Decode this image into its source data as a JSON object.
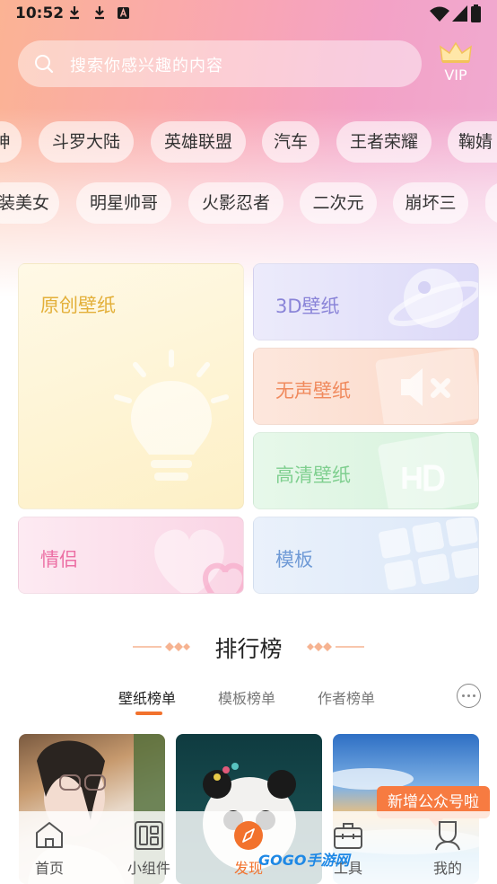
{
  "status_bar": {
    "time": "10:52"
  },
  "search": {
    "placeholder": "搜索你感兴趣的内容",
    "vip_label": "VIP"
  },
  "tags_row1": [
    "神",
    "斗罗大陆",
    "英雄联盟",
    "汽车",
    "王者荣耀",
    "鞠婧"
  ],
  "tags_row2": [
    "装美女",
    "明星帅哥",
    "火影忍者",
    "二次元",
    "崩坏三"
  ],
  "categories": [
    {
      "label": "原创壁纸",
      "color": "#e3b03a"
    },
    {
      "label": "3D壁纸",
      "color": "#8a84d8"
    },
    {
      "label": "无声壁纸",
      "color": "#f08a5d"
    },
    {
      "label": "高清壁纸",
      "color": "#7fcf8f"
    },
    {
      "label": "情侣",
      "color": "#ec6fa4"
    },
    {
      "label": "模板",
      "color": "#6f9ad6"
    }
  ],
  "ranking": {
    "title": "排行榜",
    "tabs": [
      "壁纸榜单",
      "模板榜单",
      "作者榜单"
    ],
    "active_tab": "壁纸榜单",
    "accent": "#f2722d"
  },
  "notice": "新增公众号啦",
  "bottom_nav": [
    "首页",
    "小组件",
    "发现",
    "工具",
    "我的"
  ],
  "watermark": "GOGO手游网"
}
